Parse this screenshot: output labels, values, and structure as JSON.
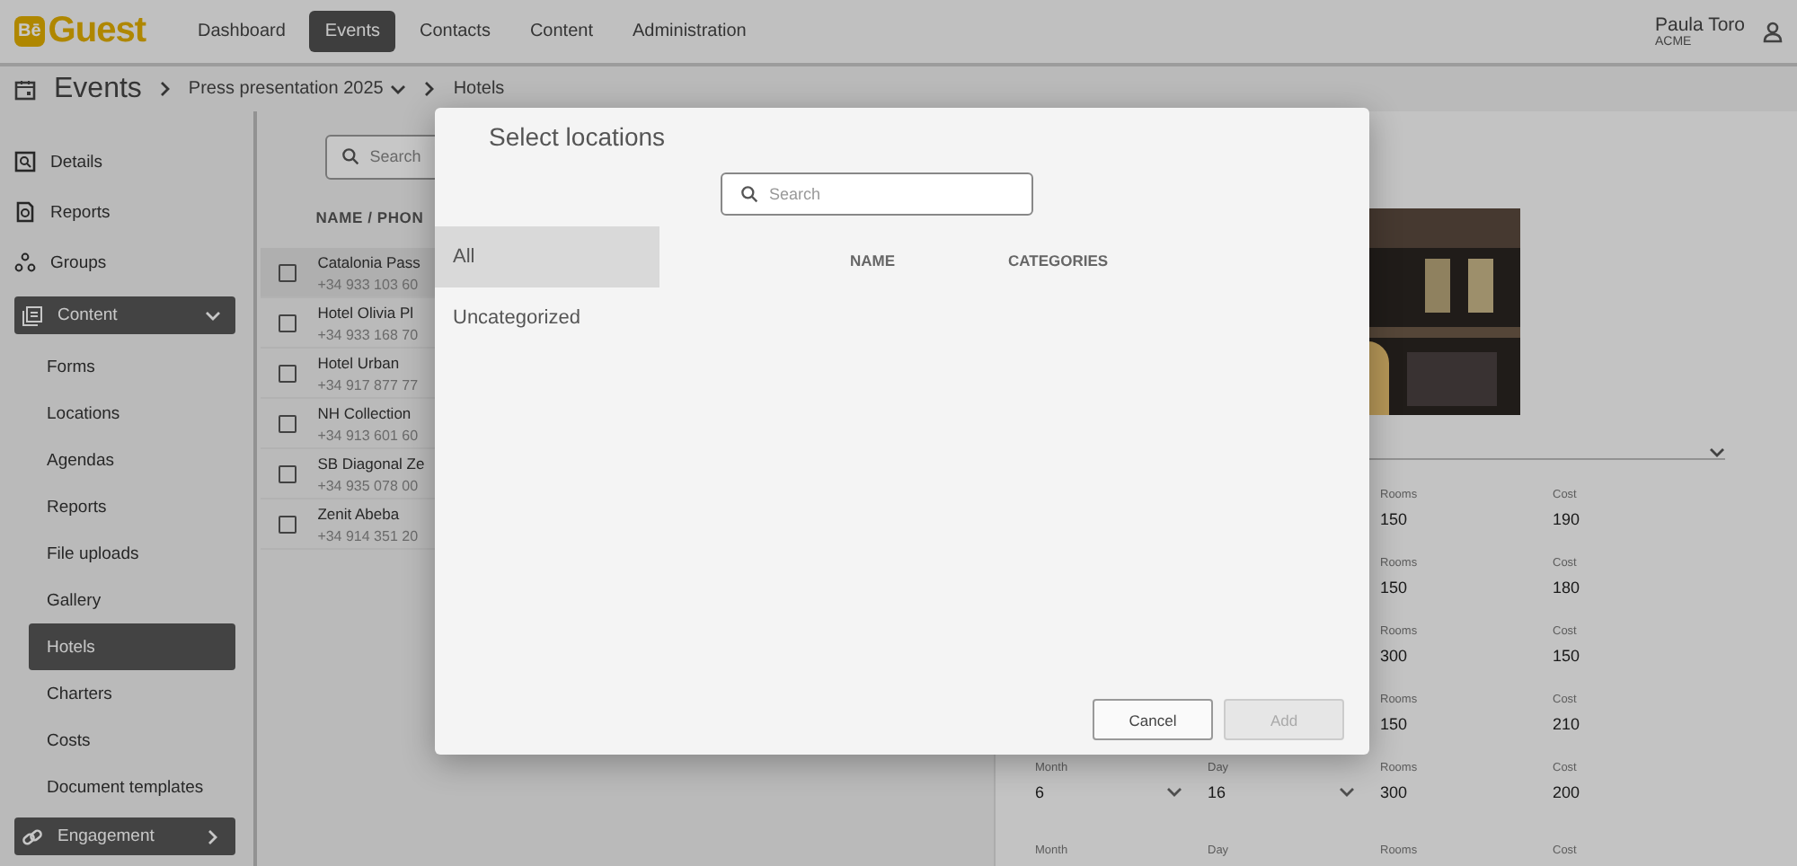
{
  "brand": {
    "mark": "Bē",
    "name": "Guest"
  },
  "nav": [
    {
      "label": "Dashboard",
      "selected": false
    },
    {
      "label": "Events",
      "selected": true
    },
    {
      "label": "Contacts",
      "selected": false
    },
    {
      "label": "Content",
      "selected": false
    },
    {
      "label": "Administration",
      "selected": false
    }
  ],
  "user": {
    "name": "Paula Toro",
    "org": "ACME"
  },
  "breadcrumb": {
    "section": "Events",
    "event": "Press presentation 2025",
    "page": "Hotels"
  },
  "sidebar": {
    "links": [
      {
        "label": "Details"
      },
      {
        "label": "Reports"
      },
      {
        "label": "Groups"
      }
    ],
    "groups": [
      {
        "label": "Content",
        "expanded": true,
        "children": [
          {
            "label": "Forms",
            "selected": false
          },
          {
            "label": "Locations",
            "selected": false
          },
          {
            "label": "Agendas",
            "selected": false
          },
          {
            "label": "Reports",
            "selected": false
          },
          {
            "label": "File uploads",
            "selected": false
          },
          {
            "label": "Gallery",
            "selected": false
          },
          {
            "label": "Hotels",
            "selected": true
          },
          {
            "label": "Charters",
            "selected": false
          },
          {
            "label": "Costs",
            "selected": false
          },
          {
            "label": "Document templates",
            "selected": false
          }
        ]
      },
      {
        "label": "Engagement",
        "expanded": false
      }
    ]
  },
  "list": {
    "search_placeholder": "Search",
    "columns": [
      "NAME / PHON"
    ],
    "rows": [
      {
        "name": "Catalonia Pass",
        "phone": "+34 933 103 60",
        "selected": true,
        "checked": false
      },
      {
        "name": "Hotel Olivia Pl",
        "phone": "+34 933 168 70",
        "selected": false,
        "checked": false
      },
      {
        "name": "Hotel Urban",
        "phone": "+34 917 877 77",
        "selected": false,
        "checked": false
      },
      {
        "name": "NH Collection",
        "phone": "+34 913 601 60",
        "selected": false,
        "checked": false
      },
      {
        "name": "SB Diagonal Ze",
        "phone": "+34 935 078 00",
        "selected": false,
        "checked": false
      },
      {
        "name": "Zenit Abeba",
        "phone": "+34 914 351 20",
        "selected": false,
        "checked": false
      }
    ]
  },
  "detail": {
    "schedule": [
      {
        "rooms_label": "Rooms",
        "rooms": "150",
        "cost_label": "Cost",
        "cost": "190"
      },
      {
        "rooms_label": "Rooms",
        "rooms": "150",
        "cost_label": "Cost",
        "cost": "180"
      },
      {
        "rooms_label": "Rooms",
        "rooms": "300",
        "cost_label": "Cost",
        "cost": "150"
      },
      {
        "rooms_label": "Rooms",
        "rooms": "150",
        "cost_label": "Cost",
        "cost": "210"
      },
      {
        "month_label": "Month",
        "month": "6",
        "day_label": "Day",
        "day": "16",
        "rooms_label": "Rooms",
        "rooms": "300",
        "cost_label": "Cost",
        "cost": "200"
      },
      {
        "month_label": "Month",
        "day_label": "Day",
        "rooms_label": "Rooms",
        "cost_label": "Cost"
      }
    ]
  },
  "modal": {
    "title": "Select locations",
    "search_placeholder": "Search",
    "categories": [
      {
        "label": "All",
        "selected": true
      },
      {
        "label": "Uncategorized",
        "selected": false
      }
    ],
    "columns": [
      "NAME",
      "CATEGORIES"
    ],
    "buttons": [
      {
        "label": "Cancel",
        "disabled": false
      },
      {
        "label": "Add",
        "disabled": true
      }
    ]
  }
}
